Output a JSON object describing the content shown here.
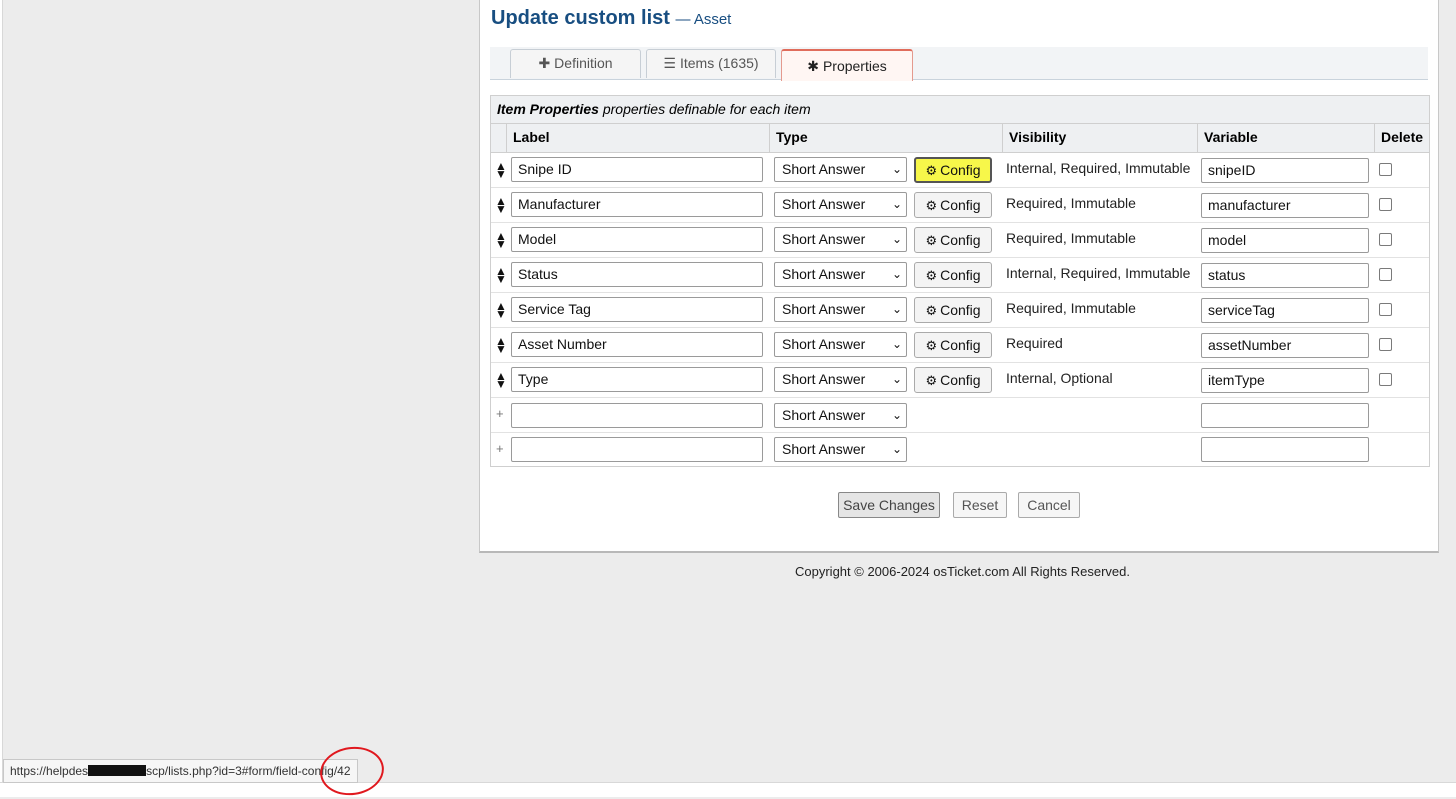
{
  "page": {
    "title": "Update custom list",
    "subtitle": "— Asset"
  },
  "tabs": [
    {
      "label": "Definition",
      "icon": "plus-icon"
    },
    {
      "label": "Items (1635)",
      "icon": "list-icon"
    },
    {
      "label": "Properties",
      "icon": "asterisk-icon",
      "active": true
    }
  ],
  "table": {
    "caption_bold": "Item Properties",
    "caption_rest": "properties definable for each item",
    "columns": [
      "Label",
      "Type",
      "Visibility",
      "Variable",
      "Delete"
    ],
    "config_label": "Config",
    "rows": [
      {
        "label": "Snipe ID",
        "type": "Short Answer",
        "visibility": "Internal, Required, Immutable",
        "variable": "snipeID"
      },
      {
        "label": "Manufacturer",
        "type": "Short Answer",
        "visibility": "Required, Immutable",
        "variable": "manufacturer"
      },
      {
        "label": "Model",
        "type": "Short Answer",
        "visibility": "Required, Immutable",
        "variable": "model"
      },
      {
        "label": "Status",
        "type": "Short Answer",
        "visibility": "Internal, Required, Immutable",
        "variable": "status"
      },
      {
        "label": "Service Tag",
        "type": "Short Answer",
        "visibility": "Required, Immutable",
        "variable": "serviceTag"
      },
      {
        "label": "Asset Number",
        "type": "Short Answer",
        "visibility": "Required",
        "variable": "assetNumber"
      },
      {
        "label": "Type",
        "type": "Short Answer",
        "visibility": "Internal, Optional",
        "variable": "itemType"
      }
    ],
    "new_rows": [
      {
        "label": "",
        "type": "Short Answer",
        "variable": ""
      },
      {
        "label": "",
        "type": "Short Answer",
        "variable": ""
      }
    ]
  },
  "buttons": {
    "save": "Save Changes",
    "reset": "Reset",
    "cancel": "Cancel"
  },
  "footer": "Copyright © 2006-2024 osTicket.com All Rights Reserved.",
  "statusbar": {
    "url_prefix": "https://helpdes",
    "url_suffix": "scp/lists.php?id=3#form/field-config/42"
  },
  "colors": {
    "title": "#184e81",
    "highlight": "#f7f74a",
    "annotation": "#e0181e"
  }
}
